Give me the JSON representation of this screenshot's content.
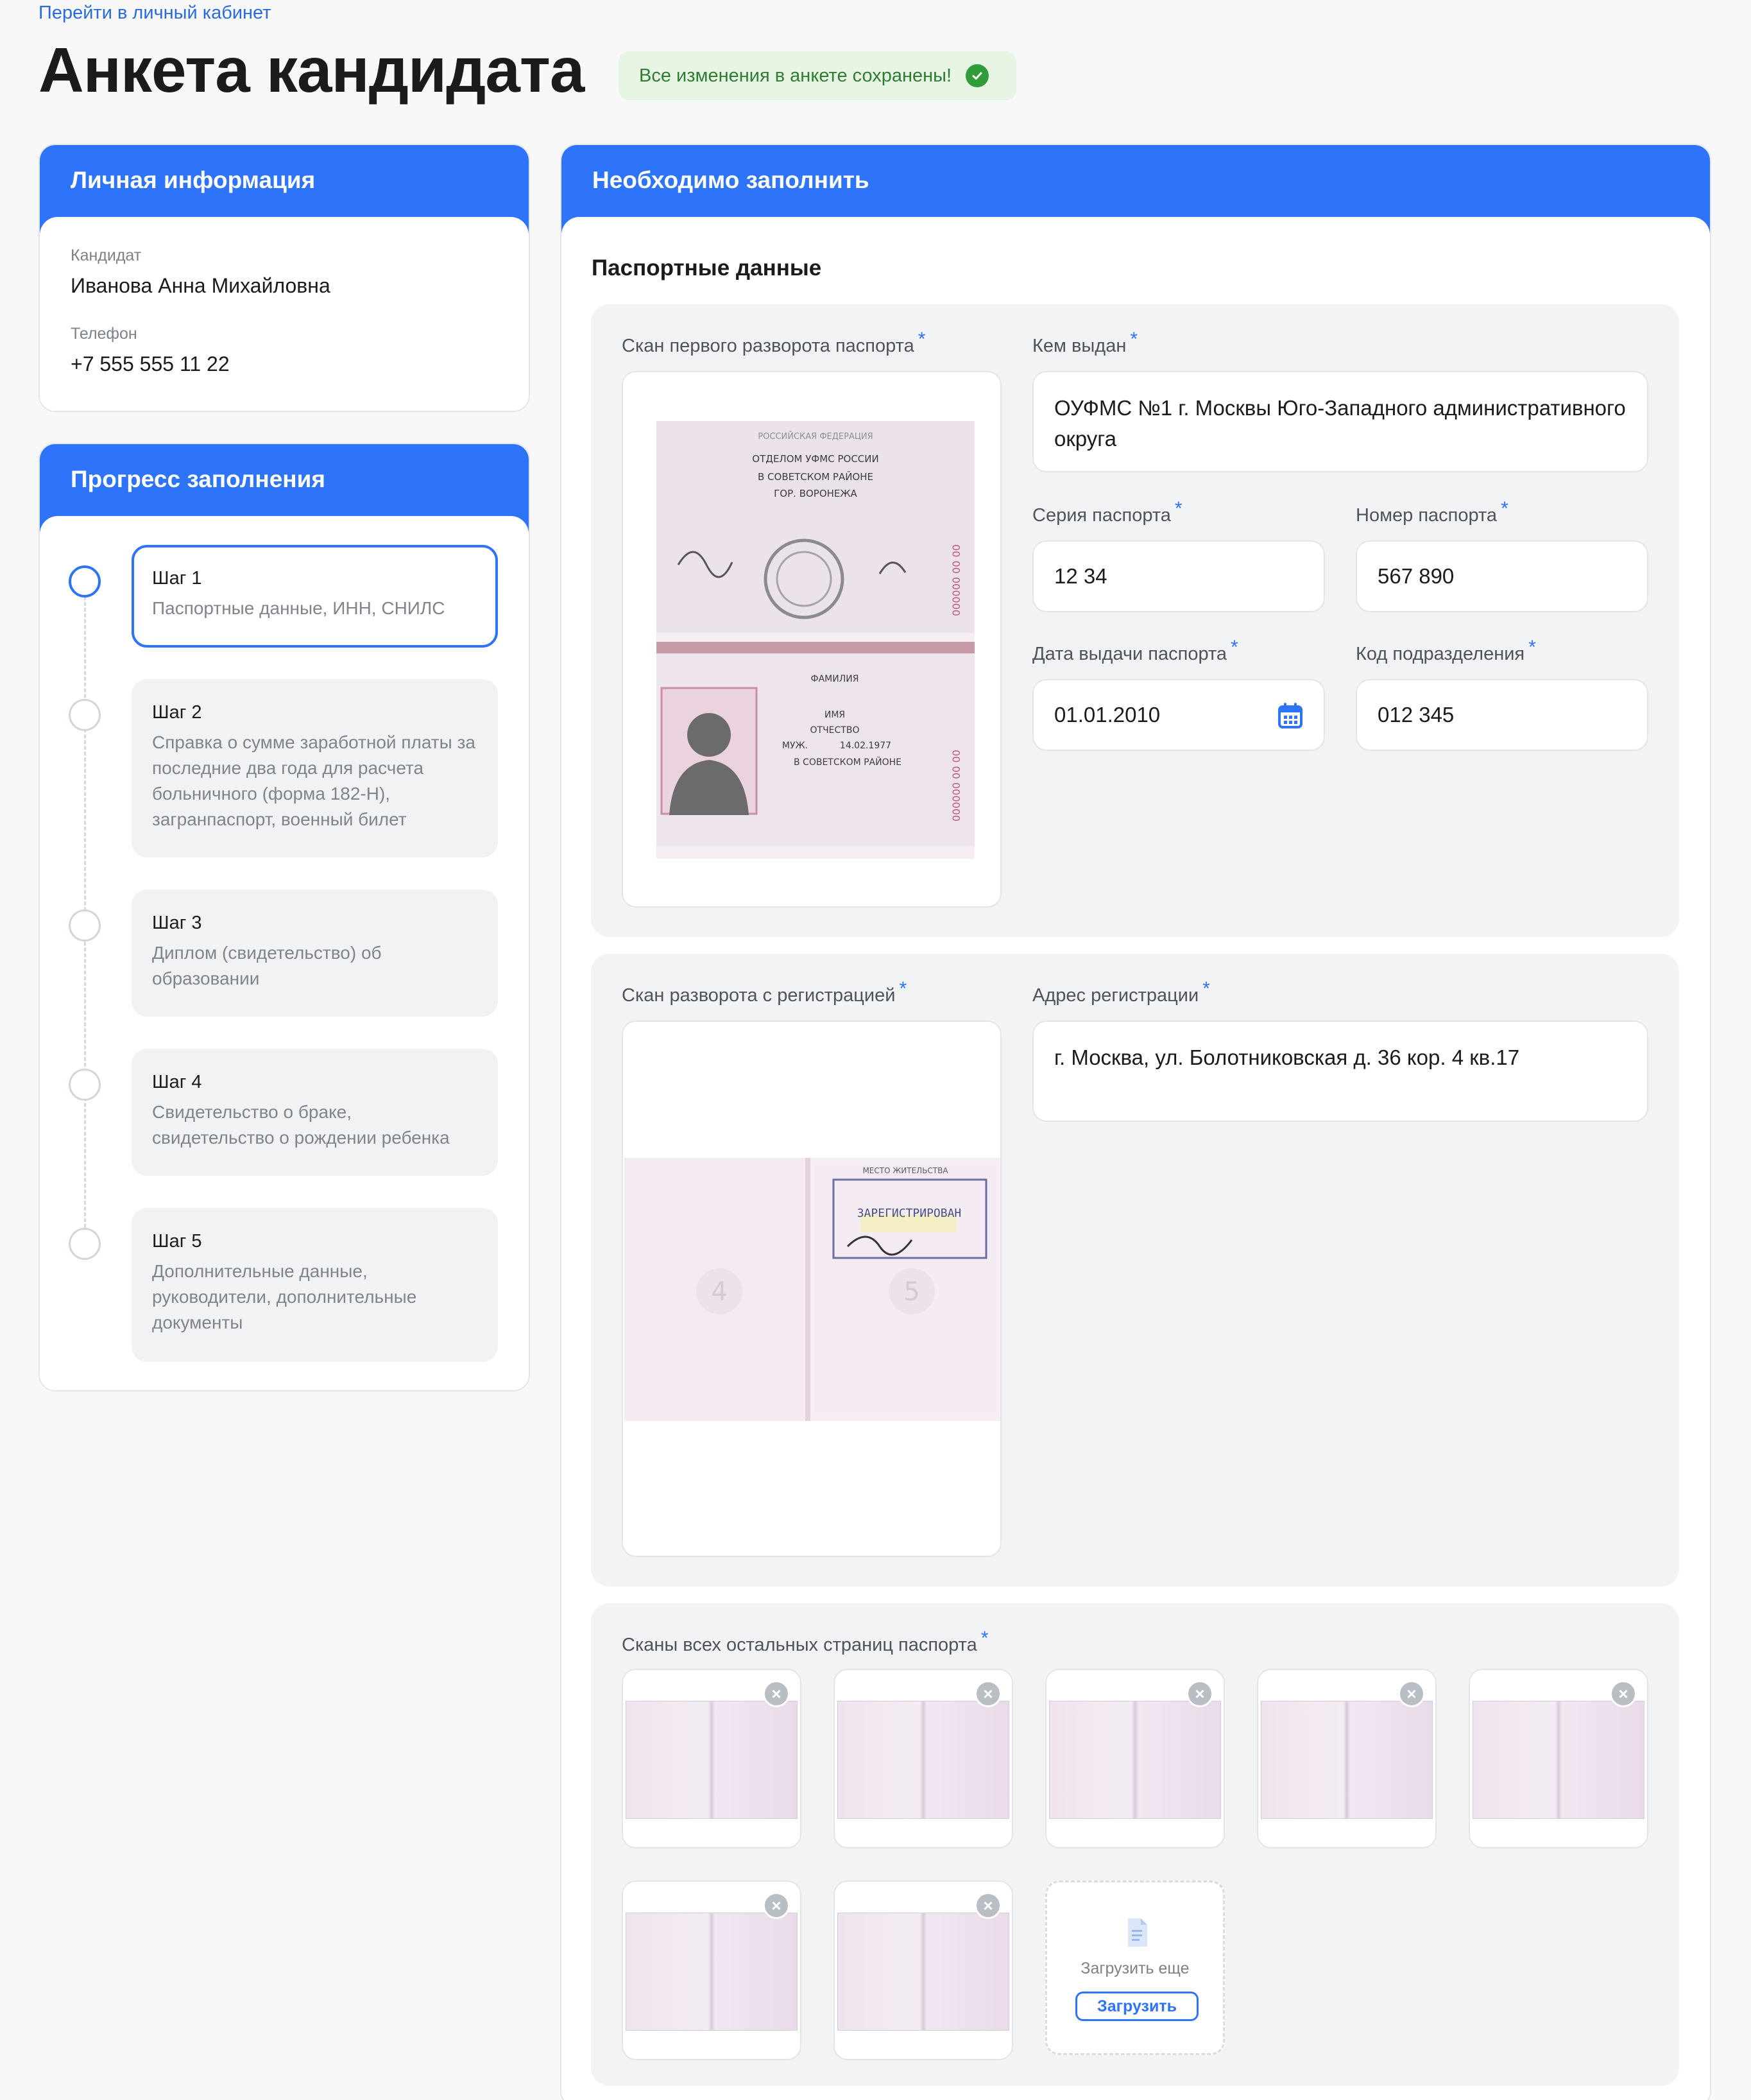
{
  "header": {
    "back_link": "Перейти в личный кабинет",
    "title": "Анкета кандидата",
    "saved_status": "Все изменения в анкете сохранены!"
  },
  "personal": {
    "title": "Личная информация",
    "candidate_label": "Кандидат",
    "candidate_value": "Иванова Анна Михайловна",
    "phone_label": "Телефон",
    "phone_value": "+7 555 555 11 22"
  },
  "progress": {
    "title": "Прогресс заполнения",
    "steps": [
      {
        "title": "Шаг 1",
        "desc": "Паспортные данные, ИНН, СНИЛС"
      },
      {
        "title": "Шаг 2",
        "desc": "Справка о сумме заработной платы за последние два года для расчета больничного (форма 182-Н), загранпаспорт, военный билет"
      },
      {
        "title": "Шаг 3",
        "desc": "Диплом (свидетельство) об образовании"
      },
      {
        "title": "Шаг 4",
        "desc": "Свидетельство о браке, свидетельство о рождении ребенка"
      },
      {
        "title": "Шаг 5",
        "desc": "Дополнительные данные, руководители, дополнительные документы"
      }
    ],
    "active_step": 1
  },
  "main": {
    "title": "Необходимо заполнить",
    "section": "Паспортные данные",
    "required_mark": "*",
    "scan_first_label": "Скан первого разворота паспорта",
    "issued_by_label": "Кем выдан",
    "issued_by_value": "ОУФМС №1 г. Москвы Юго-Западного административного округа",
    "series_label": "Серия паспорта",
    "series_value": "12 34",
    "number_label": "Номер паспорта",
    "number_value": "567 890",
    "issue_date_label": "Дата выдачи паспорта",
    "issue_date_value": "01.01.2010",
    "dept_code_label": "Код подразделения",
    "dept_code_value": "012 345",
    "scan_reg_label": "Скан разворота с регистрацией",
    "address_label": "Адрес регистрации",
    "address_value": "г. Москва, ул. Болотниковская д. 36 кор. 4 кв.17",
    "other_scans_label": "Сканы всех остальных страниц паспорта",
    "upload_more_label": "Загрузить еще",
    "upload_button": "Загрузить"
  },
  "passport_scan": {
    "country": "РОССИЙСКАЯ ФЕДЕРАЦИЯ",
    "issuer_1": "ОТДЕЛОМ УФМС РОССИИ",
    "issuer_2": "В СОВЕТСКОМ РАЙОНЕ",
    "issuer_3": "ГОР. ВОРОНЕЖА",
    "surname": "ФАМИЛИЯ",
    "name": "ИМЯ",
    "patronymic": "ОТЧЕСТВО",
    "sex": "МУЖ.",
    "birth_date": "14.02.1977",
    "birth_place": "В СОВЕТСКОМ РАЙОНЕ",
    "serial": "000000 00 00"
  },
  "registration_scan": {
    "heading": "МЕСТО ЖИТЕЛЬСТВА",
    "stamp": "ЗАРЕГИСТРИРОВАН",
    "page_left": "4",
    "page_right": "5"
  },
  "colors": {
    "accent": "#2d74fb",
    "success": "#2f9e3a",
    "background": "#f8f8f9"
  }
}
